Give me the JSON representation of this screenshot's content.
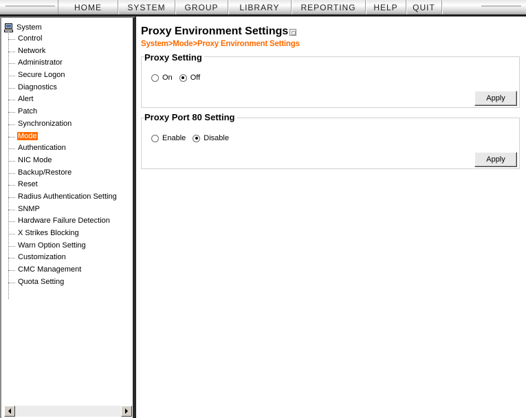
{
  "topnav": {
    "items": [
      {
        "label": "HOME",
        "width": 88
      },
      {
        "label": "SYSTEM",
        "width": 83
      },
      {
        "label": "GROUP",
        "width": 77
      },
      {
        "label": "LIBRARY",
        "width": 92
      },
      {
        "label": "REPORTING",
        "width": 108
      },
      {
        "label": "HELP",
        "width": 59
      },
      {
        "label": "QUIT",
        "width": 52
      }
    ]
  },
  "sidebar": {
    "root_label": "System",
    "items": [
      {
        "label": "Control"
      },
      {
        "label": "Network"
      },
      {
        "label": "Administrator"
      },
      {
        "label": "Secure Logon"
      },
      {
        "label": "Diagnostics"
      },
      {
        "label": "Alert"
      },
      {
        "label": "Patch"
      },
      {
        "label": "Synchronization"
      },
      {
        "label": "Mode",
        "selected": true
      },
      {
        "label": "Authentication"
      },
      {
        "label": "NIC Mode"
      },
      {
        "label": "Backup/Restore"
      },
      {
        "label": "Reset"
      },
      {
        "label": "Radius Authentication Setting"
      },
      {
        "label": "SNMP"
      },
      {
        "label": "Hardware Failure Detection"
      },
      {
        "label": "X Strikes Blocking"
      },
      {
        "label": "Warn Option Setting"
      },
      {
        "label": "Customization"
      },
      {
        "label": "CMC Management"
      },
      {
        "label": "Quota Setting"
      }
    ]
  },
  "main": {
    "title": "Proxy Environment Settings",
    "breadcrumb": "System>Mode>Proxy Environment Settings",
    "proxy_setting": {
      "title": "Proxy Setting",
      "options": [
        {
          "label": "On",
          "checked": false
        },
        {
          "label": "Off",
          "checked": true
        }
      ],
      "apply_label": "Apply"
    },
    "proxy_port_80": {
      "title": "Proxy Port 80 Setting",
      "options": [
        {
          "label": "Enable",
          "checked": false
        },
        {
          "label": "Disable",
          "checked": true
        }
      ],
      "apply_label": "Apply"
    }
  },
  "colors": {
    "accent": "#ff6a00",
    "selected_bg": "#ff6a00",
    "topbar_border": "#1e1e1e"
  },
  "icons": {
    "root": "computer-icon",
    "help": "help-icon",
    "scroll_left": "scroll-left-icon",
    "scroll_right": "scroll-right-icon"
  }
}
